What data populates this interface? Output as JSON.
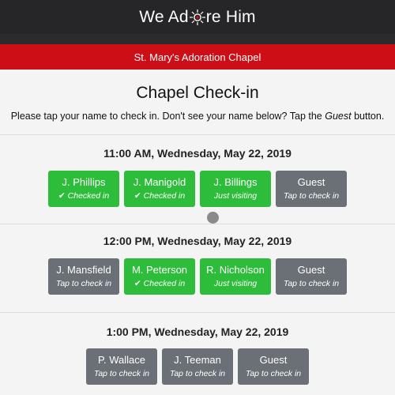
{
  "app": {
    "logo_left": "We Ad",
    "logo_right": "re Him",
    "chapel_name": "St. Mary's Adoration Chapel"
  },
  "main": {
    "title": "Chapel Check-in",
    "instructions_pre": "Please tap your name to check in. Don't see your name below? Tap the ",
    "instructions_em": "Guest",
    "instructions_post": " button."
  },
  "slots": [
    {
      "title": "11:00 AM, Wednesday, May 22, 2019",
      "buttons": [
        {
          "name": "J. Phillips",
          "status": "Checked in",
          "checked": true
        },
        {
          "name": "J. Manigold",
          "status": "Checked in",
          "checked": true
        },
        {
          "name": "J. Billings",
          "status": "Just visiting",
          "checked": false
        },
        {
          "name": "Guest",
          "status": "Tap to check in",
          "checked": false
        }
      ]
    },
    {
      "title": "12:00 PM, Wednesday, May 22, 2019",
      "buttons": [
        {
          "name": "J. Mansfield",
          "status": "Tap to check in",
          "checked": false
        },
        {
          "name": "M. Peterson",
          "status": "Checked in",
          "checked": true
        },
        {
          "name": "R. Nicholson",
          "status": "Just visiting",
          "checked": false
        },
        {
          "name": "Guest",
          "status": "Tap to check in",
          "checked": false
        }
      ]
    },
    {
      "title": "1:00 PM, Wednesday, May 22, 2019",
      "buttons": [
        {
          "name": "P. Wallace",
          "status": "Tap to check in",
          "checked": false
        },
        {
          "name": "J. Teeman",
          "status": "Tap to check in",
          "checked": false
        },
        {
          "name": "Guest",
          "status": "Tap to check in",
          "checked": false
        }
      ]
    }
  ],
  "colors": {
    "checked_in": "#2ebd3a",
    "just_visiting": "#2ebd3a",
    "not_checked": "#6b7076",
    "header": "#262628",
    "chapel_bar": "#cc0f16"
  }
}
